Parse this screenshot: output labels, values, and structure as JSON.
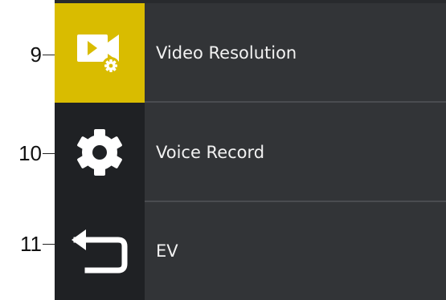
{
  "callouts": [
    "9",
    "10",
    "11"
  ],
  "menu": {
    "items": [
      {
        "label": "Video Resolution",
        "icon": "video-settings-icon",
        "selected": true
      },
      {
        "label": "Voice Record",
        "icon": "gear-icon",
        "selected": false
      },
      {
        "label": "EV",
        "icon": "back-arrow-icon",
        "selected": false
      }
    ]
  },
  "colors": {
    "selected_icon_bg": "#d9bc00",
    "icon_bg": "#1f2124",
    "label_bg": "#323437",
    "text": "#f2f2f2"
  }
}
